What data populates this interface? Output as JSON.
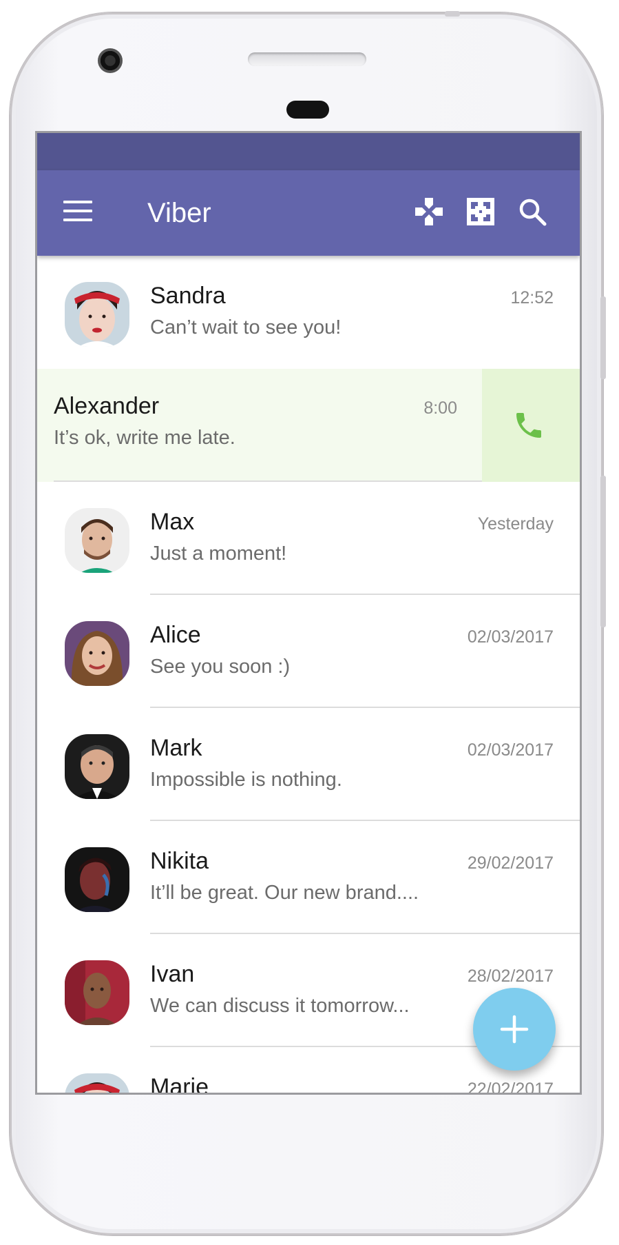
{
  "status_bar": {},
  "app_bar": {
    "title": "Viber",
    "icons": [
      "menu-icon",
      "game-controller-icon",
      "qr-scanner-icon",
      "search-icon"
    ]
  },
  "colors": {
    "status_bar": "#535590",
    "app_bar": "#6365ab",
    "swipe_row_bg": "#f4faee",
    "call_action_bg": "#e6f5d6",
    "call_icon": "#6cc04a",
    "fab": "#7fcdee"
  },
  "chats": [
    {
      "name": "Sandra",
      "message": "Can’t wait to see you!",
      "time": "12:52"
    },
    {
      "name": "Alexander",
      "message": "It’s ok, write me late.",
      "time": "8:00"
    },
    {
      "name": "Max",
      "message": "Just a moment!",
      "time": "Yesterday"
    },
    {
      "name": "Alice",
      "message": "See you soon :)",
      "time": "02/03/2017"
    },
    {
      "name": "Mark",
      "message": "Impossible is nothing.",
      "time": "02/03/2017"
    },
    {
      "name": "Nikita",
      "message": "It’ll be great. Our new brand....",
      "time": "29/02/2017"
    },
    {
      "name": "Ivan",
      "message": "We can discuss it tomorrow...",
      "time": "28/02/2017"
    },
    {
      "name": "Marie",
      "message": "",
      "time": "22/02/2017"
    }
  ],
  "swipe_action": {
    "icon": "phone-icon"
  },
  "fab": {
    "icon": "plus-icon"
  }
}
